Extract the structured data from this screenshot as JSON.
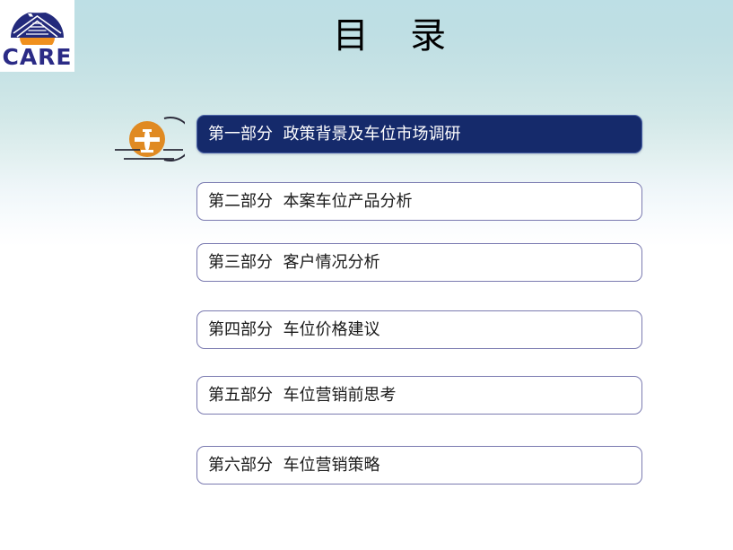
{
  "slide": {
    "title": "目   录",
    "background_top_color": "#bddfe5",
    "background_bottom_color": "#ffffff"
  },
  "logo": {
    "name": "CARE",
    "wordmark": "CARE",
    "wordmark_color": "#2b2b86",
    "dome_color": "#232a7c",
    "arc_color": "#f0901e",
    "plane_color": "#ffffff"
  },
  "bullet_icon": {
    "name": "airplane-roundel-icon",
    "circle_color": "#e08a22",
    "plane_color": "#ffffff",
    "outline_color": "#2b2b3a"
  },
  "toc": {
    "active_index": 0,
    "active_bg_color": "#152a6b",
    "active_text_color": "#ffffff",
    "plain_border_color": "#7a7ab0",
    "items": [
      {
        "number": "第一部分",
        "title": "政策背景及车位市场调研",
        "label": "第一部分  政策背景及车位市场调研",
        "active": true
      },
      {
        "number": "第二部分",
        "title": "本案车位产品分析",
        "label": "第二部分  本案车位产品分析",
        "active": false
      },
      {
        "number": "第三部分",
        "title": "客户情况分析",
        "label": "第三部分  客户情况分析",
        "active": false
      },
      {
        "number": "第四部分",
        "title": "车位价格建议",
        "label": "第四部分  车位价格建议",
        "active": false
      },
      {
        "number": "第五部分",
        "title": "车位营销前思考",
        "label": "第五部分  车位营销前思考",
        "active": false
      },
      {
        "number": "第六部分",
        "title": "车位营销策略",
        "label": "第六部分  车位营销策略",
        "active": false
      }
    ]
  }
}
